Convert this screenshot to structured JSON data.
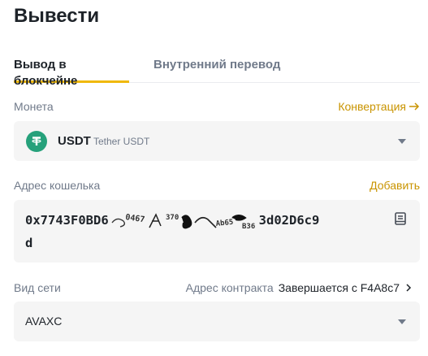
{
  "page": {
    "title": "Вывести"
  },
  "tabs": [
    {
      "label": "Вывод в блокчейне",
      "active": true
    },
    {
      "label": "Внутренний перевод",
      "active": false
    }
  ],
  "coin": {
    "label": "Монета",
    "convert_link": "Конвертация",
    "symbol": "USDT",
    "name": "Tether USDT",
    "icon": "tether-icon",
    "icon_color": "#26a17b"
  },
  "wallet": {
    "label": "Адрес кошелька",
    "add_link": "Добавить",
    "address": "0x7743F0BD6…3d02D6c9d",
    "address_start": "0x7743F0BD6",
    "address_end": "3d02D6c9",
    "address_wrap": "d"
  },
  "network": {
    "label": "Вид сети",
    "contract_label": "Адрес контракта",
    "contract_value": "Завершается с F4A8c7",
    "selected": "AVAXC"
  },
  "colors": {
    "accent": "#c99400",
    "tab_underline": "#f0b90b",
    "field_bg": "#f5f5f5"
  }
}
